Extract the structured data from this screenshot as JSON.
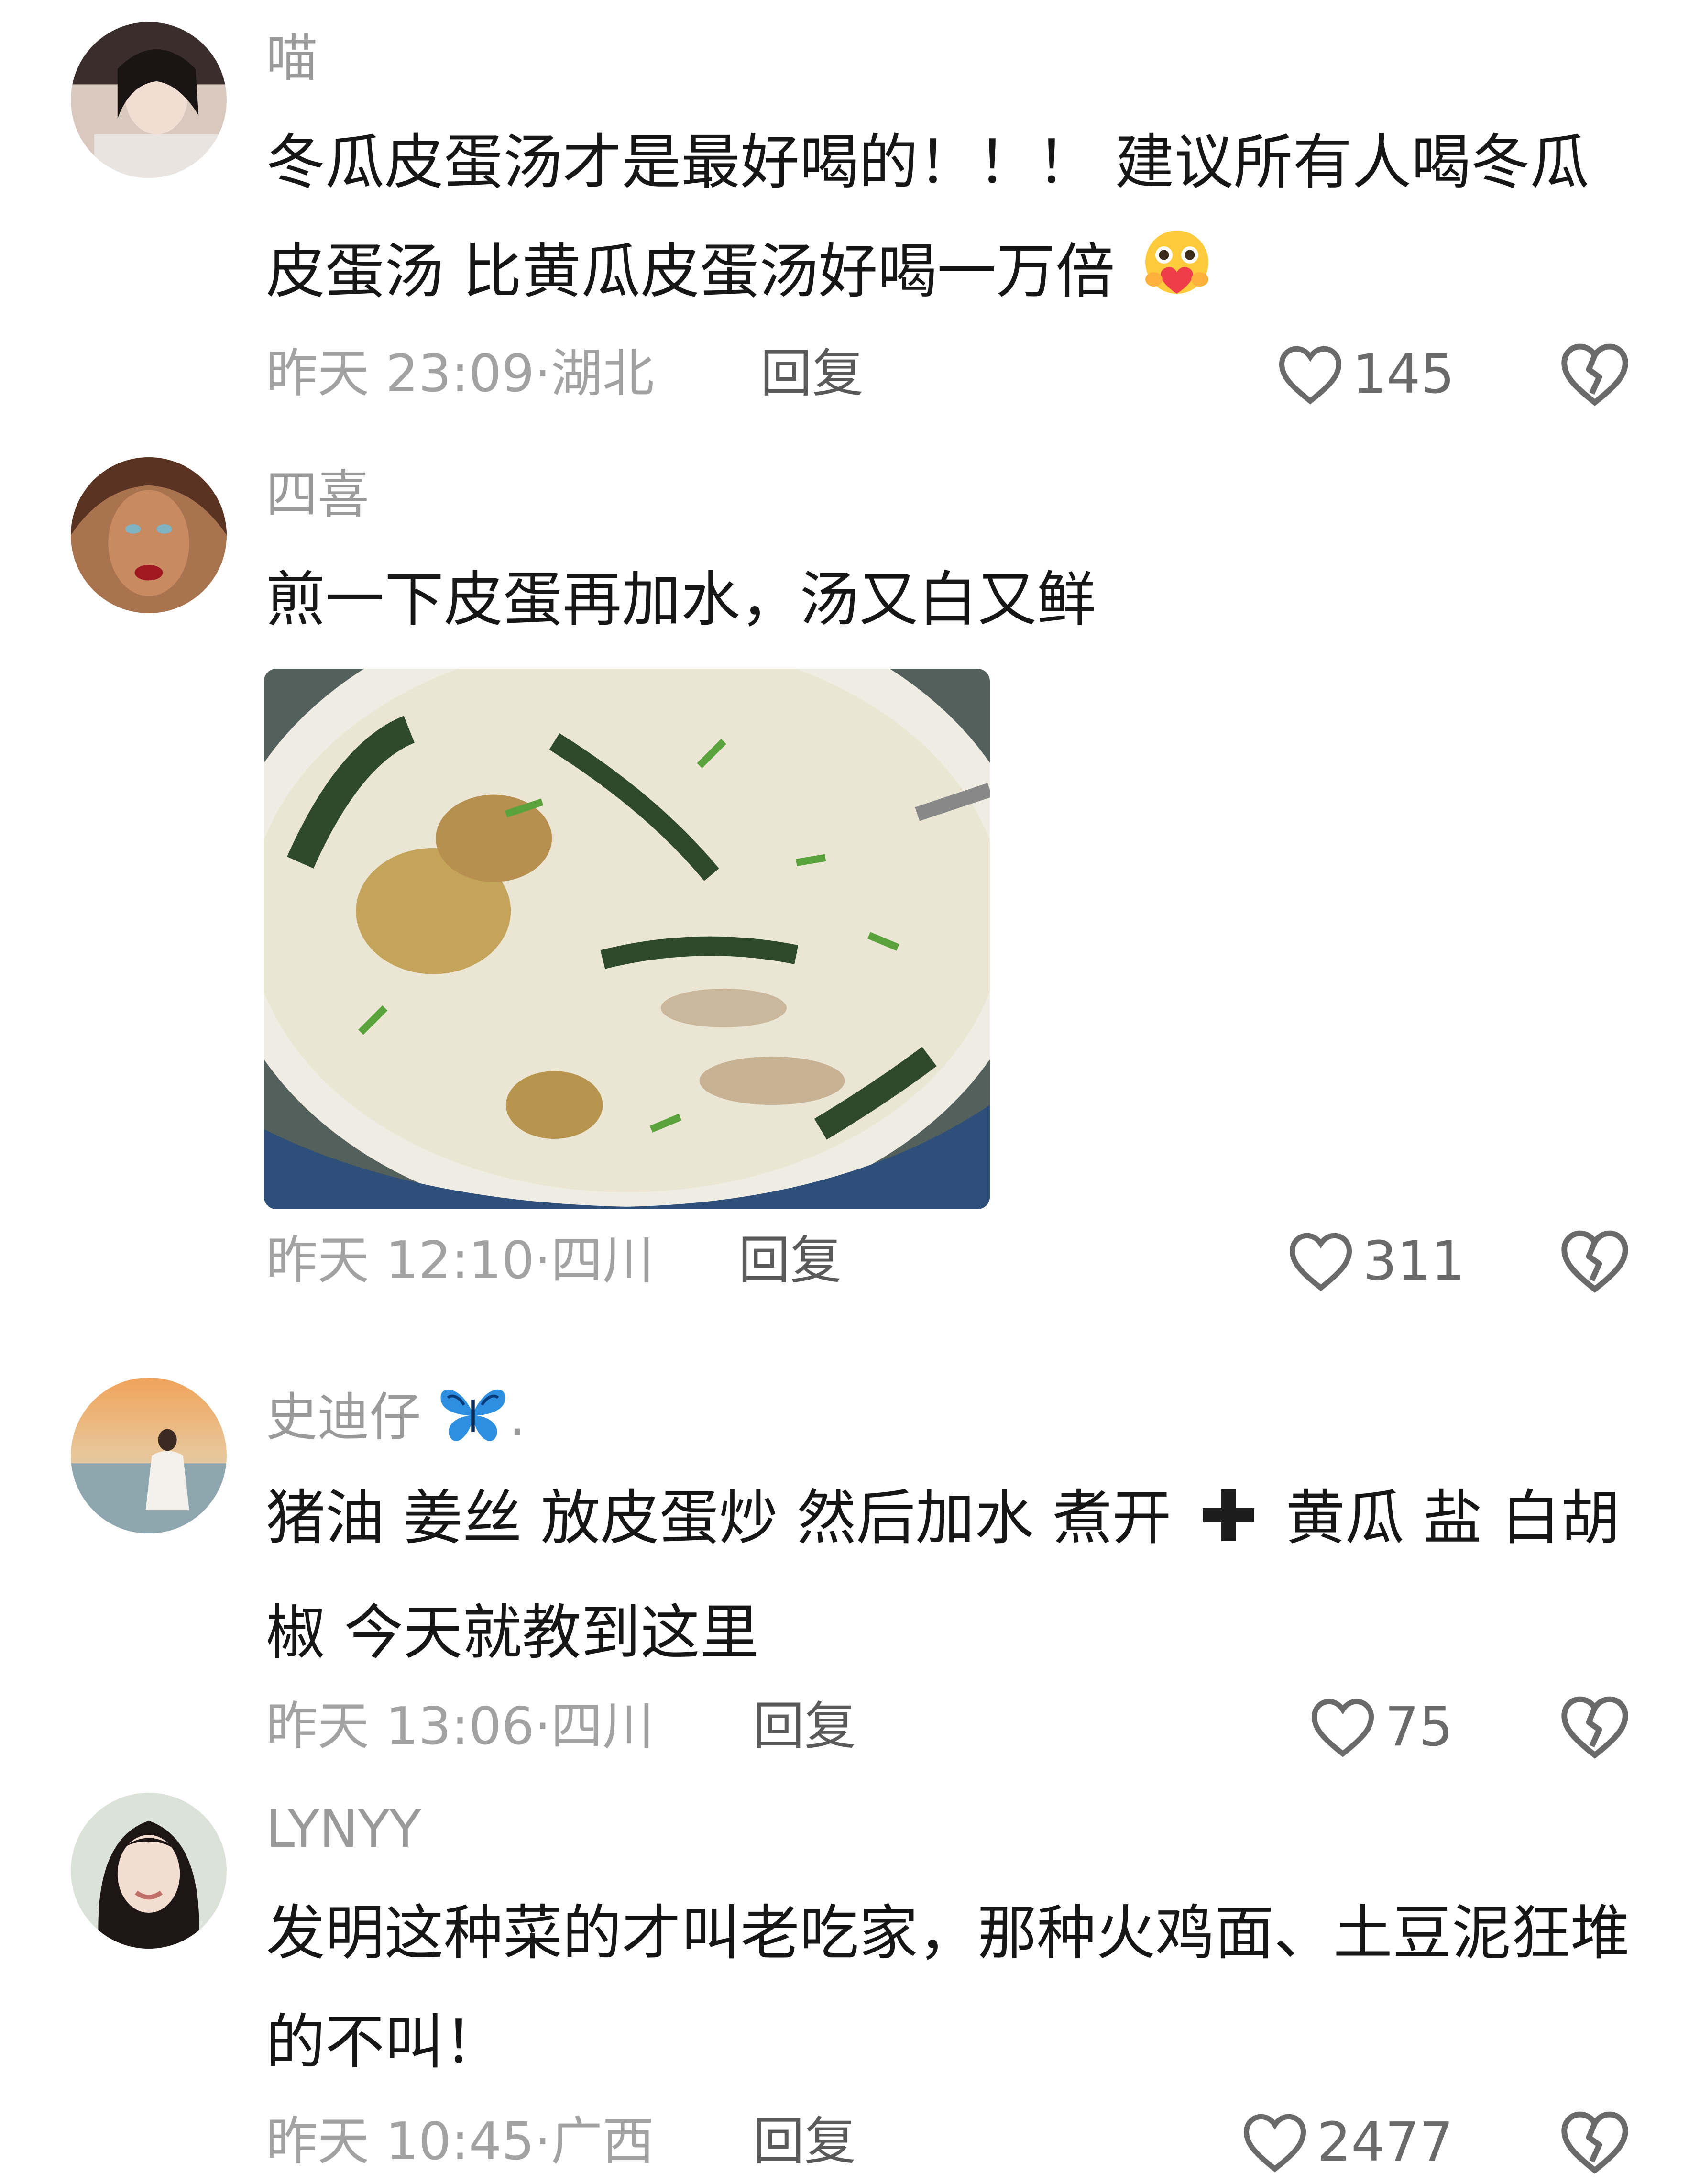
{
  "comments": [
    {
      "username": "喵",
      "text": "冬瓜皮蛋汤才是最好喝的！！！ 建议所有人喝冬瓜皮蛋汤 比黄瓜皮蛋汤好喝一万倍",
      "emoji": "smiling-face-with-heart-emoji",
      "time": "昨天 23:09",
      "location": "湖北",
      "reply": "回复",
      "likes": "145"
    },
    {
      "username": "四喜",
      "text": "煎一下皮蛋再加水，汤又白又鲜",
      "image": "soup-photo",
      "time": "昨天 12:10",
      "location": "四川",
      "reply": "回复",
      "likes": "311"
    },
    {
      "username": "史迪仔",
      "username_suffix": ".",
      "username_icon": "butterfly-icon",
      "text_part1": "猪油 姜丝 放皮蛋炒 然后加水 煮开",
      "text_icon": "plus-icon",
      "text_part2": "黄瓜 盐 白胡椒 今天就教到这里",
      "time": "昨天 13:06",
      "location": "四川",
      "reply": "回复",
      "likes": "75"
    },
    {
      "username": "LYNYY",
      "text": "发明这种菜的才叫老吃家，那种火鸡面、土豆泥狂堆的不叫！",
      "time": "昨天 10:45",
      "location": "广西",
      "reply": "回复",
      "likes": "2477"
    }
  ],
  "separator": "·",
  "colors": {
    "username": "#9a9a9a",
    "text": "#161616",
    "meta": "#a2a2a2",
    "icon": "#6a6a6a"
  }
}
